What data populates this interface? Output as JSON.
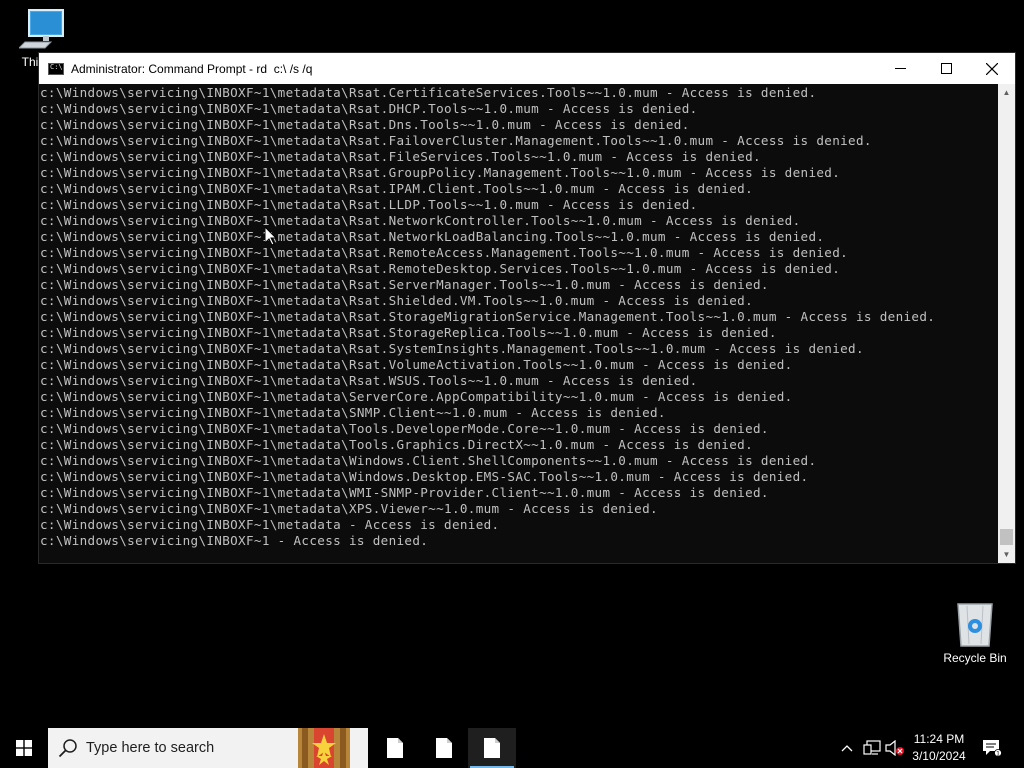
{
  "desktop": {
    "this_pc_label": "This PC",
    "recycle_bin_label": "Recycle Bin"
  },
  "window": {
    "title": "Administrator: Command Prompt - rd  c:\\ /s /q",
    "minimize_symbol": "—",
    "maximize_symbol": "☐",
    "close_symbol": "✕"
  },
  "console": {
    "lines": [
      "c:\\Windows\\servicing\\INBOXF~1\\metadata\\Rsat.CertificateServices.Tools~~1.0.mum - Access is denied.",
      "c:\\Windows\\servicing\\INBOXF~1\\metadata\\Rsat.DHCP.Tools~~1.0.mum - Access is denied.",
      "c:\\Windows\\servicing\\INBOXF~1\\metadata\\Rsat.Dns.Tools~~1.0.mum - Access is denied.",
      "c:\\Windows\\servicing\\INBOXF~1\\metadata\\Rsat.FailoverCluster.Management.Tools~~1.0.mum - Access is denied.",
      "c:\\Windows\\servicing\\INBOXF~1\\metadata\\Rsat.FileServices.Tools~~1.0.mum - Access is denied.",
      "c:\\Windows\\servicing\\INBOXF~1\\metadata\\Rsat.GroupPolicy.Management.Tools~~1.0.mum - Access is denied.",
      "c:\\Windows\\servicing\\INBOXF~1\\metadata\\Rsat.IPAM.Client.Tools~~1.0.mum - Access is denied.",
      "c:\\Windows\\servicing\\INBOXF~1\\metadata\\Rsat.LLDP.Tools~~1.0.mum - Access is denied.",
      "c:\\Windows\\servicing\\INBOXF~1\\metadata\\Rsat.NetworkController.Tools~~1.0.mum - Access is denied.",
      "c:\\Windows\\servicing\\INBOXF~1\\metadata\\Rsat.NetworkLoadBalancing.Tools~~1.0.mum - Access is denied.",
      "c:\\Windows\\servicing\\INBOXF~1\\metadata\\Rsat.RemoteAccess.Management.Tools~~1.0.mum - Access is denied.",
      "c:\\Windows\\servicing\\INBOXF~1\\metadata\\Rsat.RemoteDesktop.Services.Tools~~1.0.mum - Access is denied.",
      "c:\\Windows\\servicing\\INBOXF~1\\metadata\\Rsat.ServerManager.Tools~~1.0.mum - Access is denied.",
      "c:\\Windows\\servicing\\INBOXF~1\\metadata\\Rsat.Shielded.VM.Tools~~1.0.mum - Access is denied.",
      "c:\\Windows\\servicing\\INBOXF~1\\metadata\\Rsat.StorageMigrationService.Management.Tools~~1.0.mum - Access is denied.",
      "c:\\Windows\\servicing\\INBOXF~1\\metadata\\Rsat.StorageReplica.Tools~~1.0.mum - Access is denied.",
      "c:\\Windows\\servicing\\INBOXF~1\\metadata\\Rsat.SystemInsights.Management.Tools~~1.0.mum - Access is denied.",
      "c:\\Windows\\servicing\\INBOXF~1\\metadata\\Rsat.VolumeActivation.Tools~~1.0.mum - Access is denied.",
      "c:\\Windows\\servicing\\INBOXF~1\\metadata\\Rsat.WSUS.Tools~~1.0.mum - Access is denied.",
      "c:\\Windows\\servicing\\INBOXF~1\\metadata\\ServerCore.AppCompatibility~~1.0.mum - Access is denied.",
      "c:\\Windows\\servicing\\INBOXF~1\\metadata\\SNMP.Client~~1.0.mum - Access is denied.",
      "c:\\Windows\\servicing\\INBOXF~1\\metadata\\Tools.DeveloperMode.Core~~1.0.mum - Access is denied.",
      "c:\\Windows\\servicing\\INBOXF~1\\metadata\\Tools.Graphics.DirectX~~1.0.mum - Access is denied.",
      "c:\\Windows\\servicing\\INBOXF~1\\metadata\\Windows.Client.ShellComponents~~1.0.mum - Access is denied.",
      "c:\\Windows\\servicing\\INBOXF~1\\metadata\\Windows.Desktop.EMS-SAC.Tools~~1.0.mum - Access is denied.",
      "c:\\Windows\\servicing\\INBOXF~1\\metadata\\WMI-SNMP-Provider.Client~~1.0.mum - Access is denied.",
      "c:\\Windows\\servicing\\INBOXF~1\\metadata\\XPS.Viewer~~1.0.mum - Access is denied.",
      "c:\\Windows\\servicing\\INBOXF~1\\metadata - Access is denied.",
      "c:\\Windows\\servicing\\INBOXF~1 - Access is denied."
    ]
  },
  "taskbar": {
    "search_placeholder": "Type here to search",
    "clock_time": "11:24 PM",
    "clock_date": "3/10/2024",
    "accent_color": "#76b9ed"
  }
}
